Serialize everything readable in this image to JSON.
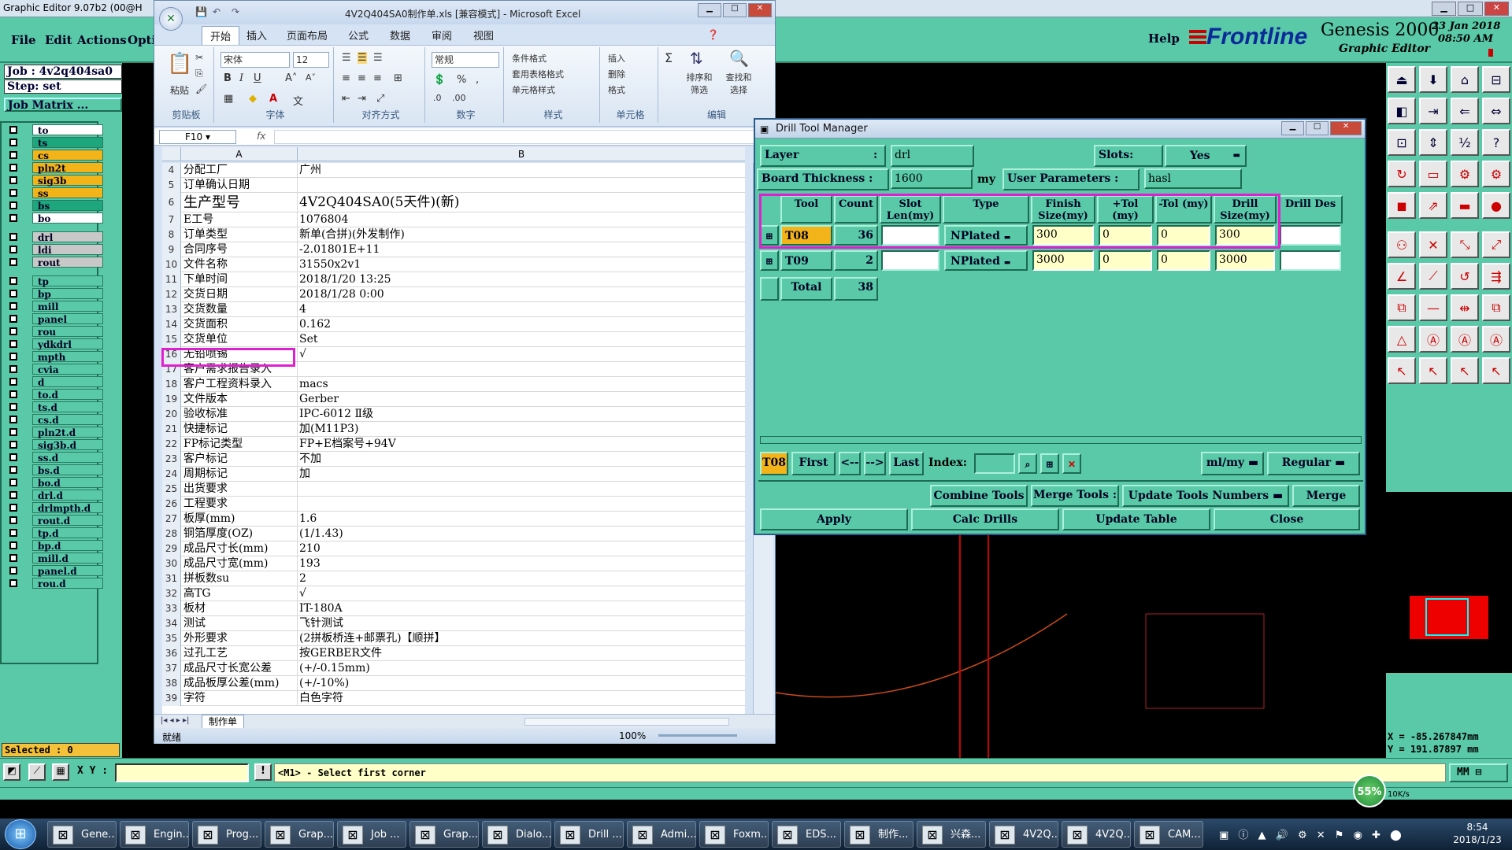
{
  "genesis": {
    "title": "Graphic Editor 9.07b2 (00@H",
    "menu": [
      "File",
      "Edit",
      "Actions",
      "Opti"
    ],
    "help": "Help",
    "brand": "Frontline",
    "product": "Genesis 2000",
    "subtitle": "Graphic Editor",
    "date": "23 Jan 2018",
    "time": "08:50 AM",
    "job_label": "Job : 4v2q404sa0",
    "step_label": "Step: set",
    "job_matrix": "Job Matrix ...",
    "layers": [
      {
        "name": "to",
        "color": "#ffffff"
      },
      {
        "name": "ts",
        "color": "#1ea67c"
      },
      {
        "name": "cs",
        "color": "#f2b418"
      },
      {
        "name": "pln2t",
        "color": "#f2b418"
      },
      {
        "name": "sig3b",
        "color": "#f2b418"
      },
      {
        "name": "ss",
        "color": "#f2b418"
      },
      {
        "name": "bs",
        "color": "#1ea67c"
      },
      {
        "name": "bo",
        "color": "#ffffff"
      },
      {
        "name": "drl",
        "color": "#c8c8c8"
      },
      {
        "name": "ldi",
        "color": "#c8c8c8"
      },
      {
        "name": "rout",
        "color": "#c8c8c8"
      },
      {
        "name": "tp",
        "color": "#59c9a7"
      },
      {
        "name": "bp",
        "color": "#59c9a7"
      },
      {
        "name": "mill",
        "color": "#59c9a7"
      },
      {
        "name": "panel",
        "color": "#59c9a7"
      },
      {
        "name": "rou",
        "color": "#59c9a7"
      },
      {
        "name": "ydkdrl",
        "color": "#59c9a7"
      },
      {
        "name": "mpth",
        "color": "#59c9a7"
      },
      {
        "name": "cvia",
        "color": "#59c9a7"
      },
      {
        "name": "d",
        "color": "#59c9a7"
      },
      {
        "name": "to.d",
        "color": "#59c9a7"
      },
      {
        "name": "ts.d",
        "color": "#59c9a7"
      },
      {
        "name": "cs.d",
        "color": "#59c9a7"
      },
      {
        "name": "pln2t.d",
        "color": "#59c9a7"
      },
      {
        "name": "sig3b.d",
        "color": "#59c9a7"
      },
      {
        "name": "ss.d",
        "color": "#59c9a7"
      },
      {
        "name": "bs.d",
        "color": "#59c9a7"
      },
      {
        "name": "bo.d",
        "color": "#59c9a7"
      },
      {
        "name": "drl.d",
        "color": "#59c9a7"
      },
      {
        "name": "drlmpth.d",
        "color": "#59c9a7"
      },
      {
        "name": "rout.d",
        "color": "#59c9a7"
      },
      {
        "name": "tp.d",
        "color": "#59c9a7"
      },
      {
        "name": "bp.d",
        "color": "#59c9a7"
      },
      {
        "name": "mill.d",
        "color": "#59c9a7"
      },
      {
        "name": "panel.d",
        "color": "#59c9a7"
      },
      {
        "name": "rou.d",
        "color": "#59c9a7"
      }
    ],
    "selected": "Selected : 0",
    "xy_label": "X Y :",
    "prompt": "<M1> - Select first corner",
    "units": "MM",
    "coord_x": "X = -85.267847mm",
    "coord_y": "Y = 191.87897 mm",
    "net_percent": "55%",
    "net_up": "10K/s",
    "net_down": "10K/s"
  },
  "excel": {
    "title": "4V2Q404SA0制作单.xls [兼容模式] - Microsoft Excel",
    "tabs": [
      "开始",
      "插入",
      "页面布局",
      "公式",
      "数据",
      "审阅",
      "视图"
    ],
    "font_name": "宋体",
    "font_size": "12",
    "number_format": "常规",
    "paste_label": "粘贴",
    "groups": [
      "剪贴板",
      "字体",
      "对齐方式",
      "数字",
      "样式",
      "单元格",
      "编辑"
    ],
    "style_items": [
      "条件格式",
      "套用表格格式",
      "单元格样式"
    ],
    "cell_items": [
      "插入",
      "删除",
      "格式"
    ],
    "edit_items": [
      "排序和筛选",
      "查找和选择"
    ],
    "name_box": "F10",
    "fx": "fx",
    "col_a": "A",
    "col_b": "B",
    "rows": [
      {
        "n": "4",
        "a": "分配工厂",
        "b": "广州"
      },
      {
        "n": "5",
        "a": "订单确认日期",
        "b": ""
      },
      {
        "n": "6",
        "a": "生产型号",
        "b": "4V2Q404SA0(5天件)(新)"
      },
      {
        "n": "7",
        "a": "E工号",
        "b": "1076804"
      },
      {
        "n": "8",
        "a": "订单类型",
        "b": "新单(合拼)(外发制作)"
      },
      {
        "n": "9",
        "a": "合同序号",
        "b": "-2.01801E+11"
      },
      {
        "n": "10",
        "a": "文件名称",
        "b": "31550x2v1"
      },
      {
        "n": "11",
        "a": "下单时间",
        "b": "2018/1/20 13:25"
      },
      {
        "n": "12",
        "a": "交货日期",
        "b": "2018/1/28 0:00"
      },
      {
        "n": "13",
        "a": "交货数量",
        "b": "4"
      },
      {
        "n": "14",
        "a": "交货面积",
        "b": "0.162"
      },
      {
        "n": "15",
        "a": "交货单位",
        "b": "Set"
      },
      {
        "n": "16",
        "a": "无铅喷锡",
        "b": "√"
      },
      {
        "n": "17",
        "a": "客户需求报告录入",
        "b": ""
      },
      {
        "n": "18",
        "a": "客户工程资料录入",
        "b": "macs"
      },
      {
        "n": "19",
        "a": "文件版本",
        "b": "Gerber"
      },
      {
        "n": "20",
        "a": "验收标准",
        "b": "IPC-6012 Ⅱ级"
      },
      {
        "n": "21",
        "a": "快捷标记",
        "b": "加(M11P3)"
      },
      {
        "n": "22",
        "a": "FP标记类型",
        "b": "FP+E档案号+94V"
      },
      {
        "n": "23",
        "a": "客户标记",
        "b": "不加"
      },
      {
        "n": "24",
        "a": "周期标记",
        "b": "加"
      },
      {
        "n": "25",
        "a": "出货要求",
        "b": ""
      },
      {
        "n": "26",
        "a": "工程要求",
        "b": ""
      },
      {
        "n": "27",
        "a": "板厚(mm)",
        "b": "1.6"
      },
      {
        "n": "28",
        "a": "铜箔厚度(OZ)",
        "b": " (1/1.43)"
      },
      {
        "n": "29",
        "a": "成品尺寸长(mm)",
        "b": "210"
      },
      {
        "n": "30",
        "a": "成品尺寸宽(mm)",
        "b": "193"
      },
      {
        "n": "31",
        "a": "拼板数su",
        "b": "2"
      },
      {
        "n": "32",
        "a": "高TG",
        "b": "√"
      },
      {
        "n": "33",
        "a": "板材",
        "b": "IT-180A"
      },
      {
        "n": "34",
        "a": "测试",
        "b": "飞针测试"
      },
      {
        "n": "35",
        "a": "外形要求",
        "b": "(2拼板桥连+邮票孔)【顺拼】"
      },
      {
        "n": "36",
        "a": "过孔工艺",
        "b": "按GERBER文件"
      },
      {
        "n": "37",
        "a": "成品尺寸长宽公差",
        "b": "(+/-0.15mm)"
      },
      {
        "n": "38",
        "a": "成品板厚公差(mm)",
        "b": "(+/-10%)"
      },
      {
        "n": "39",
        "a": "字符",
        "b": "白色字符"
      }
    ],
    "sheet_tab": "制作单",
    "status": "就绪",
    "zoom": "100%"
  },
  "dtm": {
    "title": "Drill Tool Manager",
    "layer_label": "Layer",
    "layer_value": "drl",
    "slots_label": "Slots:",
    "slots_value": "Yes",
    "thickness_label": "Board Thickness :",
    "thickness_value": "1600",
    "thickness_unit": "my",
    "user_params_label": "User Parameters :",
    "user_params_value": "hasl",
    "headers": {
      "tool": "Tool",
      "count": "Count",
      "slot": "Slot Len(my)",
      "type": "Type",
      "finish": "Finish Size(my)",
      "ptol": "+Tol (my)",
      "mtol": "-Tol (my)",
      "drill": "Drill Size(my)",
      "des": "Drill Des"
    },
    "rows": [
      {
        "tool": "T08",
        "count": "36",
        "type": "NPlated",
        "finish": "300",
        "ptol": "0",
        "mtol": "0",
        "drill": "300"
      },
      {
        "tool": "T09",
        "count": "2",
        "type": "NPlated",
        "finish": "3000",
        "ptol": "0",
        "mtol": "0",
        "drill": "3000"
      }
    ],
    "total_label": "Total",
    "total_value": "38",
    "current_tool": "T08",
    "nav": {
      "first": "First",
      "prev": "<--",
      "next": "-->",
      "last": "Last",
      "index": "Index:"
    },
    "units": "ml/my",
    "mode": "Regular",
    "combine": "Combine Tools",
    "merge_tools": "Merge Tools :",
    "update_numbers": "Update Tools Numbers",
    "merge": "Merge",
    "apply": "Apply",
    "calc": "Calc Drills",
    "update_table": "Update Table",
    "close": "Close"
  },
  "taskbar": {
    "tasks": [
      "Gene...",
      "Engin...",
      "Prog...",
      "Grap...",
      "Job ...",
      "Grap...",
      "Dialo...",
      "Drill ...",
      "Admi...",
      "Foxm...",
      "EDS...",
      "制作...",
      "兴森...",
      "4V2Q...",
      "4V2Q...",
      "CAM..."
    ],
    "time": "8:54",
    "date": "2018/1/23"
  }
}
